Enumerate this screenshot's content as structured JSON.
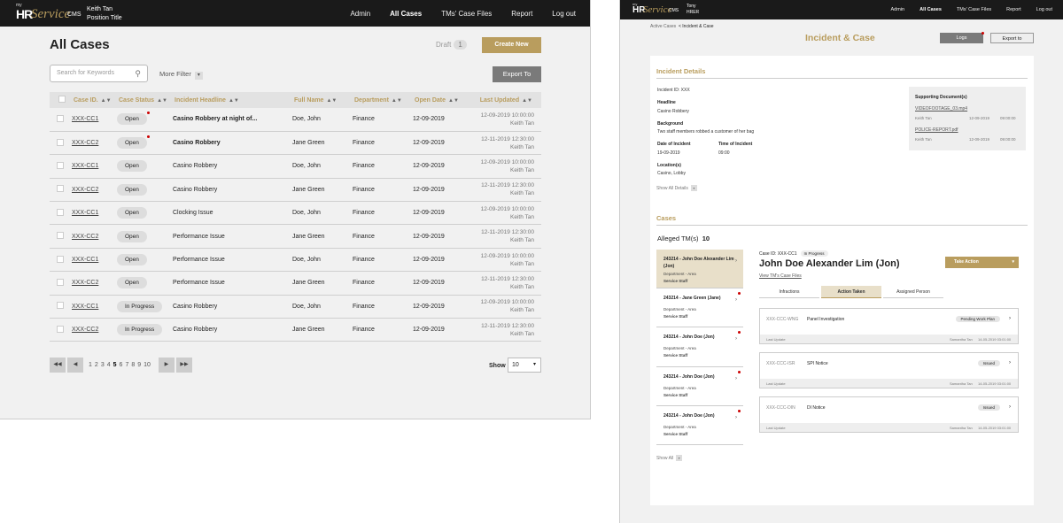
{
  "left": {
    "brand": {
      "my": "my",
      "hr": "HR",
      "service": "Service",
      "cms": "CMS"
    },
    "user": {
      "name": "Keith Tan",
      "title": "Position Title"
    },
    "nav": [
      "Admin",
      "All Cases",
      "TMs' Case Files",
      "Report",
      "Log out"
    ],
    "page_title": "All Cases",
    "draft_label": "Draft",
    "draft_count": "1",
    "create_label": "Create New",
    "search_placeholder": "Search for Keywords",
    "more_filter": "More Filter",
    "export_label": "Export To",
    "columns": [
      "Case ID.",
      "Case Status",
      "Incident Headline",
      "Full Name",
      "Department",
      "Open Date",
      "Last Updated"
    ],
    "rows": [
      {
        "id": "XXX-CC1",
        "status": "Open",
        "headline": "Casino Robbery at night of...",
        "name": "Doe, John",
        "dept": "Finance",
        "open": "12-09-2019",
        "updated": "12-09-2019 10:00:00",
        "by": "Keith Tan"
      },
      {
        "id": "XXX-CC2",
        "status": "Open",
        "headline": "Casino Robbery",
        "name": "Jane Green",
        "dept": "Finance",
        "open": "12-09-2019",
        "updated": "12-11-2019 12:30:00",
        "by": "Keith Tan"
      },
      {
        "id": "XXX-CC1",
        "status": "Open",
        "headline": "Casino Robbery",
        "name": "Doe, John",
        "dept": "Finance",
        "open": "12-09-2019",
        "updated": "12-09-2019 10:00:00",
        "by": "Keith Tan"
      },
      {
        "id": "XXX-CC2",
        "status": "Open",
        "headline": "Casino Robbery",
        "name": "Jane Green",
        "dept": "Finance",
        "open": "12-09-2019",
        "updated": "12-11-2019 12:30:00",
        "by": "Keith Tan"
      },
      {
        "id": "XXX-CC1",
        "status": "Open",
        "headline": "Clocking Issue",
        "name": "Doe, John",
        "dept": "Finance",
        "open": "12-09-2019",
        "updated": "12-09-2019 10:00:00",
        "by": "Keith Tan"
      },
      {
        "id": "XXX-CC2",
        "status": "Open",
        "headline": "Performance Issue",
        "name": "Jane Green",
        "dept": "Finance",
        "open": "12-09-2019",
        "updated": "12-11-2019 12:30:00",
        "by": "Keith Tan"
      },
      {
        "id": "XXX-CC1",
        "status": "Open",
        "headline": "Performance Issue",
        "name": "Doe, John",
        "dept": "Finance",
        "open": "12-09-2019",
        "updated": "12-09-2019 10:00:00",
        "by": "Keith Tan"
      },
      {
        "id": "XXX-CC2",
        "status": "Open",
        "headline": "Performance Issue",
        "name": "Jane Green",
        "dept": "Finance",
        "open": "12-09-2019",
        "updated": "12-11-2019 12:30:00",
        "by": "Keith Tan"
      },
      {
        "id": "XXX-CC1",
        "status": "In Progress",
        "headline": "Casino Robbery",
        "name": "Doe, John",
        "dept": "Finance",
        "open": "12-09-2019",
        "updated": "12-09-2019 10:00:00",
        "by": "Keith Tan"
      },
      {
        "id": "XXX-CC2",
        "status": "In Progress",
        "headline": "Casino Robbery",
        "name": "Jane Green",
        "dept": "Finance",
        "open": "12-09-2019",
        "updated": "12-11-2019 12:30:00",
        "by": "Keith Tan"
      }
    ],
    "pages": [
      "1",
      "2",
      "3",
      "4",
      "5",
      "6",
      "7",
      "8",
      "9",
      "10"
    ],
    "current_page": "5",
    "show_label": "Show",
    "show_value": "10"
  },
  "right": {
    "brand": {
      "my": "my",
      "hr": "HR",
      "service": "Service",
      "cms": "CMS"
    },
    "user": {
      "name": "Tony",
      "title": "HRER"
    },
    "nav": [
      "Admin",
      "All Cases",
      "TMs' Case Files",
      "Report",
      "Log out"
    ],
    "breadcrumb": {
      "root": "Active Cases",
      "current": "< Incident & Case"
    },
    "title": "Incident & Case",
    "logs_label": "Logs",
    "export_label": "Export to",
    "incident_details_heading": "Incident Details",
    "incident_id": "Incident ID: XXX",
    "headline_label": "Headline",
    "headline_value": "Casino Robbery",
    "background_label": "Background",
    "background_value": "Two staff members robbed a customer of her bag",
    "date_label": "Date of Incident",
    "date_value": "19-09-2019",
    "time_label": "Time of Incident",
    "time_value": "09:00",
    "location_label": "Location(s)",
    "location_value": "Casino, Lobby",
    "show_all_details": "Show All Details",
    "docs_heading": "Supporting Document(s)",
    "docs": [
      {
        "file": "VIDEOFOOTAGE_03.mp4",
        "by": "Keith Tan",
        "date": "12-09-2019",
        "time": "09:00:00"
      },
      {
        "file": "POLICE-REPORT.pdf",
        "by": "Keith Tan",
        "date": "12-09-2019",
        "time": "09:00:00"
      }
    ],
    "cases_heading": "Cases",
    "alleged_label": "Alleged TM(s)",
    "alleged_count": "10",
    "tms": [
      {
        "name": "243214 - John Doe Alexander Lim (Jon)",
        "dept": "Department - Area",
        "role": "Service Staff"
      },
      {
        "name": "243214 - Jane Green (Jane)",
        "dept": "Department - Area",
        "role": "Service Staff"
      },
      {
        "name": "243214 - John Doe (Jon)",
        "dept": "Department - Area",
        "role": "Service Staff"
      },
      {
        "name": "243214 - John Doe (Jon)",
        "dept": "Department - Area",
        "role": "Service Staff"
      },
      {
        "name": "243214 - John Doe (Jon)",
        "dept": "Department - Area",
        "role": "Service Staff"
      }
    ],
    "show_all": "Show All",
    "case_id": "Case ID: XXX-CC1",
    "case_status": "In Progress",
    "case_name": "John Doe Alexander Lim (Jon)",
    "view_files": "View TM's Case Files",
    "take_action": "Take Action",
    "tabs": [
      "Infractions",
      "Action Taken",
      "Assigned Person"
    ],
    "actions": [
      {
        "code": "XXX-CCC-WNG",
        "name": "Panel Investigation",
        "status": "Pending Work Plan",
        "last": "Last Update",
        "by": "Samantha Tan",
        "date": "14-05-2019 03:01:00"
      },
      {
        "code": "XXX-CCC-ISR",
        "name": "SPI Notice",
        "status": "Issued",
        "last": "Last Update",
        "by": "Samantha Tan",
        "date": "14-05-2019 03:01:00"
      },
      {
        "code": "XXX-CCC-DIN",
        "name": "DI Notice",
        "status": "Issued",
        "last": "Last Update",
        "by": "Samantha Tan",
        "date": "14-05-2019 03:01:00"
      }
    ]
  }
}
